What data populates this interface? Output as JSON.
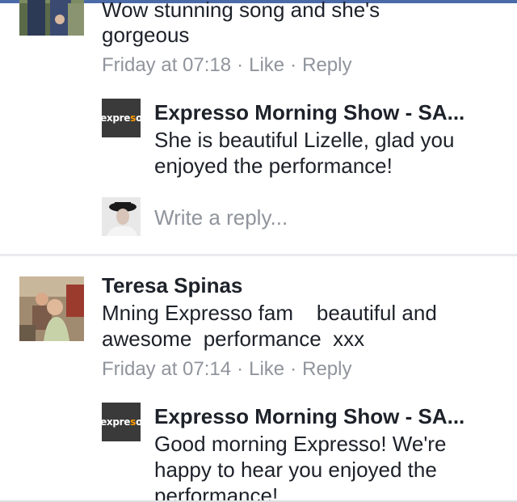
{
  "comment1": {
    "text_line1": "Wow stunning song and she's",
    "text_line2": "gorgeous",
    "time": "Friday at 07:18",
    "like": "Like",
    "reply": "Reply",
    "dot": "·"
  },
  "reply1": {
    "author": "Expresso Morning Show - SA...",
    "logo_text_a": "expre",
    "logo_text_b": "s",
    "logo_text_c": "o",
    "text_line1": "She is beautiful Lizelle, glad you",
    "text_line2": "enjoyed the performance!"
  },
  "write_reply": {
    "placeholder": "Write a reply..."
  },
  "comment2": {
    "author": "Teresa Spinas",
    "text_line1": "Mning Expresso fam    beautiful and",
    "text_line2": "awesome  performance  xxx",
    "time": "Friday at 07:14",
    "like": "Like",
    "reply": "Reply",
    "dot": "·"
  },
  "reply2": {
    "author": "Expresso Morning Show - SA...",
    "logo_text_a": "expre",
    "logo_text_b": "s",
    "logo_text_c": "o",
    "text_line1": "Good morning Expresso! We're",
    "text_line2": "happy to hear you enjoyed the",
    "text_line3": "performance!"
  }
}
